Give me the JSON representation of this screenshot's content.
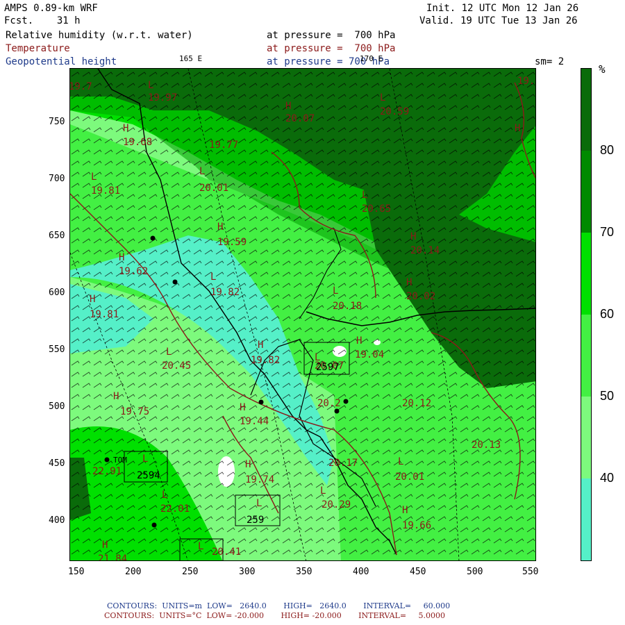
{
  "header": {
    "model": "AMPS 0.89-km WRF",
    "fcst": "Fcst.    31 h",
    "init": "Init. 12 UTC Mon 12 Jan 26",
    "valid": "Valid. 19 UTC Tue 13 Jan 26",
    "field1": "Relative humidity (w.r.t. water)",
    "field1_level": "at pressure =  700 hPa",
    "field2": "Temperature",
    "field2_level": "at pressure =  700 hPa",
    "field3": "Geopotential height",
    "field3_level": "at pressure = 700 hPa",
    "lon_label_a": "165 E",
    "lon_label_b": "170 E",
    "smooth": "sm= 2"
  },
  "axes": {
    "x_ticks": [
      "150",
      "200",
      "250",
      "300",
      "350",
      "400",
      "450",
      "500",
      "550"
    ],
    "y_ticks": [
      "750",
      "700",
      "650",
      "600",
      "550",
      "500",
      "450",
      "400"
    ]
  },
  "colorbar": {
    "unit": "%",
    "labels": [
      "80",
      "70",
      "60",
      "50",
      "40"
    ],
    "colors": {
      "above_80": "#0a6b0a",
      "70_80": "#008a00",
      "60_70": "#00e000",
      "50_60": "#43f043",
      "40_50": "#7dfa7d",
      "below_40": "#55f0c8"
    }
  },
  "map_labels": {
    "temperature": [
      "19.97",
      "20.07",
      "20.59",
      "19.68",
      "19.77",
      "19.81",
      "20.01",
      "20.65",
      "19.59",
      "20.14",
      "19.62",
      "19.82",
      "20.18",
      "20.02",
      "19.81",
      "20.45",
      "19.82",
      "20.07",
      "19.04",
      "19.75",
      "19.44",
      "20.12",
      "20.13",
      "22.91",
      "19.74",
      "20.17",
      "20.01",
      "22.01",
      "20.29",
      "19.66",
      "21.84",
      "20.41",
      "19.7",
      "19.7",
      "20.2"
    ],
    "height_boxes": [
      "2594",
      "2597",
      "2597",
      "259"
    ],
    "station": "TOM"
  },
  "footer": {
    "line1": "CONTOURS:  UNITS=m  LOW=   2640.0       HIGH=   2640.0       INTERVAL=     60.000",
    "line2": "CONTOURS:  UNITS=°C  LOW= -20.000       HIGH= -20.000       INTERVAL=     5.0000"
  }
}
